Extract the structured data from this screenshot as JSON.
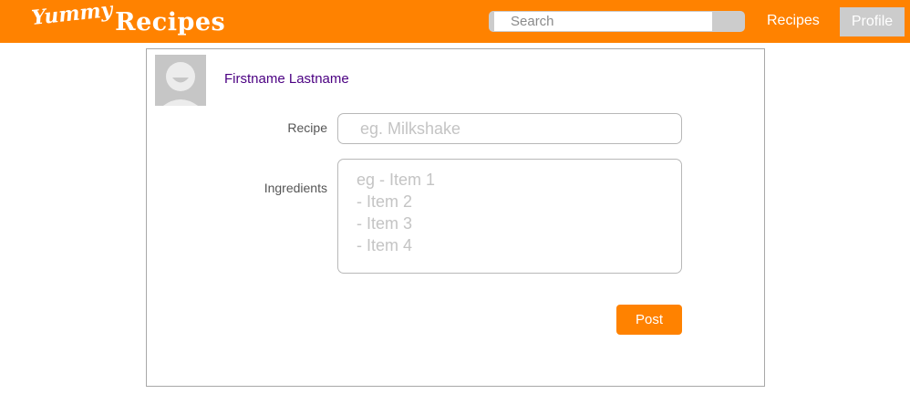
{
  "brand": {
    "logo_part1": "Yummy",
    "logo_part2": "Recipes"
  },
  "search": {
    "placeholder": "Search",
    "value": ""
  },
  "nav": {
    "recipes_label": "Recipes",
    "profile_label": "Profile"
  },
  "post_form": {
    "user_name": "Firstname Lastname",
    "recipe_label": "Recipe",
    "recipe_placeholder": "eg. Milkshake",
    "ingredients_label": "Ingredients",
    "ingredients_placeholder": "eg - Item 1\n- Item 2\n- Item 3\n- Item 4",
    "post_button_label": "Post"
  },
  "colors": {
    "brand_orange": "#ff8200",
    "profile_tab_bg": "#cccccc",
    "username_text": "#4b0082"
  },
  "icons": {
    "avatar": "default-user-avatar-icon",
    "search_button": "search-submit-button"
  }
}
